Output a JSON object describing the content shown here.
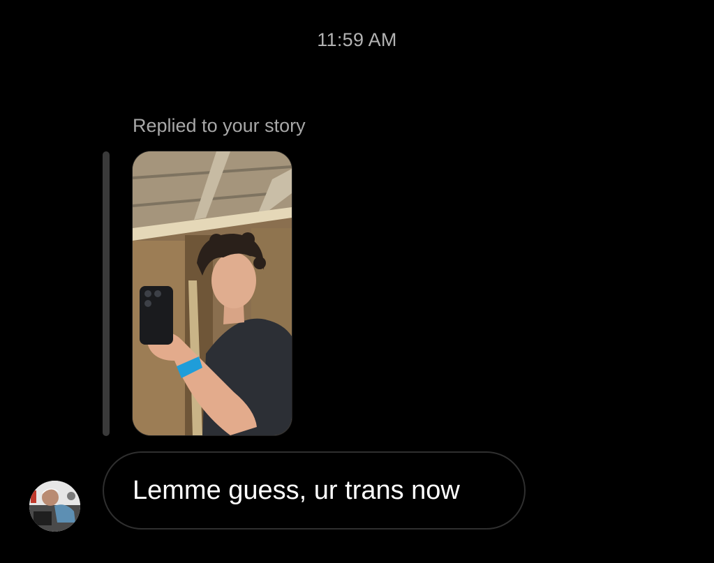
{
  "conversation": {
    "timestamp": "11:59 AM",
    "story_reply": {
      "label": "Replied to your story",
      "thumbnail_icon": "story-image"
    },
    "messages": [
      {
        "sender": "other",
        "avatar_icon": "avatar-image",
        "text": "Lemme guess, ur trans now"
      }
    ]
  },
  "colors": {
    "background": "#000000",
    "timestamp_text": "#b3b3b3",
    "label_text": "#a8a8a8",
    "bubble_border": "#2f2f2f",
    "message_text": "#ffffff"
  }
}
